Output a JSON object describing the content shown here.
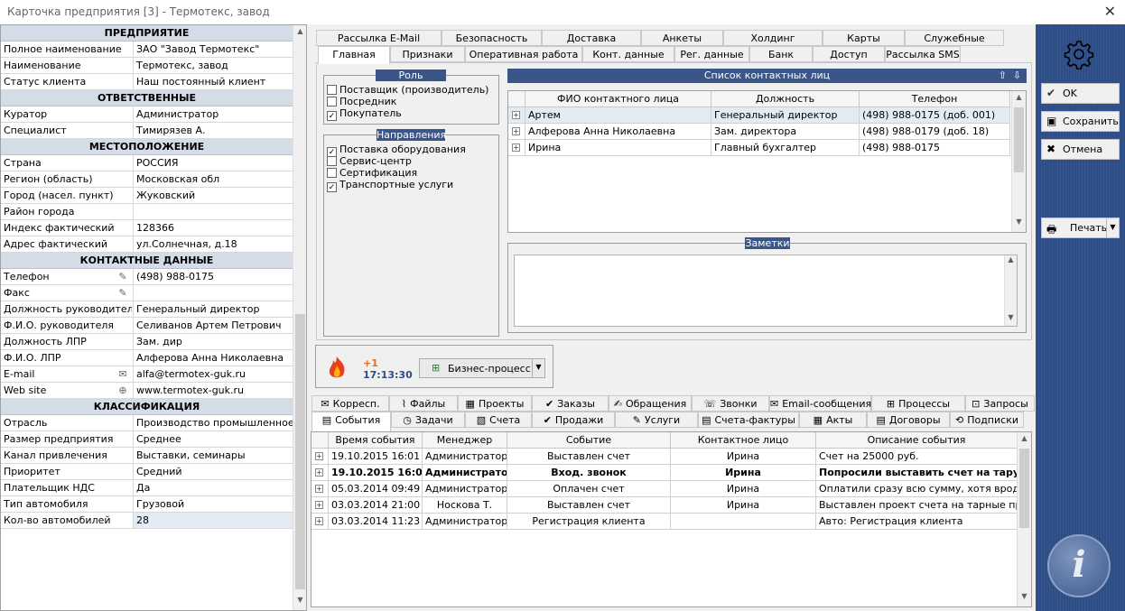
{
  "window": {
    "title": "Карточка предприятия [3] - Термотекс, завод",
    "close": "✕"
  },
  "left": {
    "sections": [
      {
        "header": "ПРЕДПРИЯТИЕ",
        "rows": [
          [
            "Полное наименование",
            "ЗАО \"Завод Термотекс\""
          ],
          [
            "Наименование",
            "Термотекс, завод"
          ],
          [
            "Статус клиента",
            "Наш постоянный клиент"
          ]
        ]
      },
      {
        "header": "ОТВЕТСТВЕННЫЕ",
        "rows": [
          [
            "Куратор",
            "Администратор"
          ],
          [
            "Специалист",
            "Тимирязев А."
          ]
        ]
      },
      {
        "header": "МЕСТОПОЛОЖЕНИЕ",
        "rows": [
          [
            "Страна",
            "РОССИЯ"
          ],
          [
            "Регион (область)",
            "Московская обл"
          ],
          [
            "Город (насел. пункт)",
            "Жуковский"
          ],
          [
            "Район города",
            ""
          ],
          [
            "Индекс фактический",
            "128366"
          ],
          [
            "Адрес фактический",
            "ул.Солнечная, д.18"
          ]
        ]
      },
      {
        "header": "КОНТАКТНЫЕ ДАННЫЕ",
        "rows": [
          [
            "Телефон",
            "(498) 988-0175"
          ],
          [
            "Факс",
            ""
          ],
          [
            "Должность руководителя",
            "Генеральный директор"
          ],
          [
            "Ф.И.О. руководителя",
            "Селиванов Артем Петрович"
          ],
          [
            "Должность ЛПР",
            "Зам. дир"
          ],
          [
            "Ф.И.О. ЛПР",
            "Алферова Анна Николаевна"
          ],
          [
            "E-mail",
            "alfa@termotex-guk.ru"
          ],
          [
            "Web site",
            "www.termotex-guk.ru"
          ]
        ]
      },
      {
        "header": "КЛАССИФИКАЦИЯ",
        "rows": [
          [
            "Отрасль",
            "Производство промышленное"
          ],
          [
            "Размер предприятия",
            "Среднее"
          ],
          [
            "Канал привлечения",
            "Выставки, семинары"
          ],
          [
            "Приоритет",
            "Средний"
          ],
          [
            "Плательщик НДС",
            "Да"
          ],
          [
            "Тип автомобиля",
            "Грузовой"
          ],
          [
            "Кол-во автомобилей",
            "28"
          ]
        ]
      }
    ]
  },
  "tabs_top_row": [
    "Рассылка E-Mail",
    "Безопасность",
    "Доставка",
    "Анкеты",
    "Холдинг",
    "Карты",
    "Служебные"
  ],
  "tabs_bottom_row": [
    "Главная",
    "Признаки",
    "Оперативная работа",
    "Конт. данные",
    "Рег. данные",
    "Банк",
    "Доступ",
    "Рассылка SMS"
  ],
  "role": {
    "title": "Роль клиента",
    "items": [
      {
        "label": "Поставщик (производитель)",
        "checked": false
      },
      {
        "label": "Посредник",
        "checked": false
      },
      {
        "label": "Покупатель",
        "checked": true
      }
    ]
  },
  "directions": {
    "title": "Направления",
    "items": [
      {
        "label": "Поставка оборудования",
        "checked": true
      },
      {
        "label": "Сервис-центр",
        "checked": false
      },
      {
        "label": "Сертификация",
        "checked": false
      },
      {
        "label": "Транспортные услуги",
        "checked": true
      }
    ]
  },
  "contacts": {
    "title": "Список контактных лиц",
    "columns": [
      "ФИО контактного лица",
      "Должность",
      "Телефон"
    ],
    "rows": [
      [
        "Артем",
        "Генеральный директор",
        "(498) 988-0175 (доб. 001)"
      ],
      [
        "Алферова Анна Николаевна",
        "Зам. директора",
        "(498) 988-0179 (доб. 18)"
      ],
      [
        "Ирина",
        "Главный бухгалтер",
        "(498) 988-0175"
      ]
    ]
  },
  "notes": {
    "title": "Заметки",
    "value": ""
  },
  "event_widget": {
    "count": "+1",
    "time": "17:13:30",
    "bp_label": "Бизнес-процесс"
  },
  "lower_tabs_top": [
    "Корресп.",
    "Файлы",
    "Проекты",
    "Заказы",
    "Обращения",
    "Звонки",
    "Email-сообщения",
    "Процессы",
    "Запросы"
  ],
  "lower_tabs_bottom": [
    "События",
    "Задачи",
    "Счета",
    "Продажи",
    "Услуги",
    "Счета-фактуры",
    "Акты",
    "Договоры",
    "Подписки"
  ],
  "events": {
    "columns": [
      "Время события",
      "Менеджер",
      "Событие",
      "Контактное лицо",
      "Описание события"
    ],
    "rows": [
      [
        "19.10.2015 16:01",
        "Администратор",
        "Выставлен счет",
        "Ирина",
        "Счет на 25000 руб."
      ],
      [
        "19.10.2015 16:01",
        "Администратор",
        "Вход. звонок",
        "Ирина",
        "Попросили выставить счет на тару"
      ],
      [
        "05.03.2014 09:49",
        "Администратор",
        "Оплачен счет",
        "Ирина",
        "Оплатили сразу всю сумму, хотя вроде ..."
      ],
      [
        "03.03.2014 21:00",
        "Носкова Т.",
        "Выставлен счет",
        "Ирина",
        "Выставлен проект счета на тарные прод..."
      ],
      [
        "03.03.2014 11:23",
        "Администратор",
        "Регистрация клиента",
        "",
        "Авто: Регистрация клиента"
      ]
    ]
  },
  "right": {
    "ok": "OK",
    "save": "Сохранить",
    "cancel": "Отмена",
    "print": "Печать"
  }
}
